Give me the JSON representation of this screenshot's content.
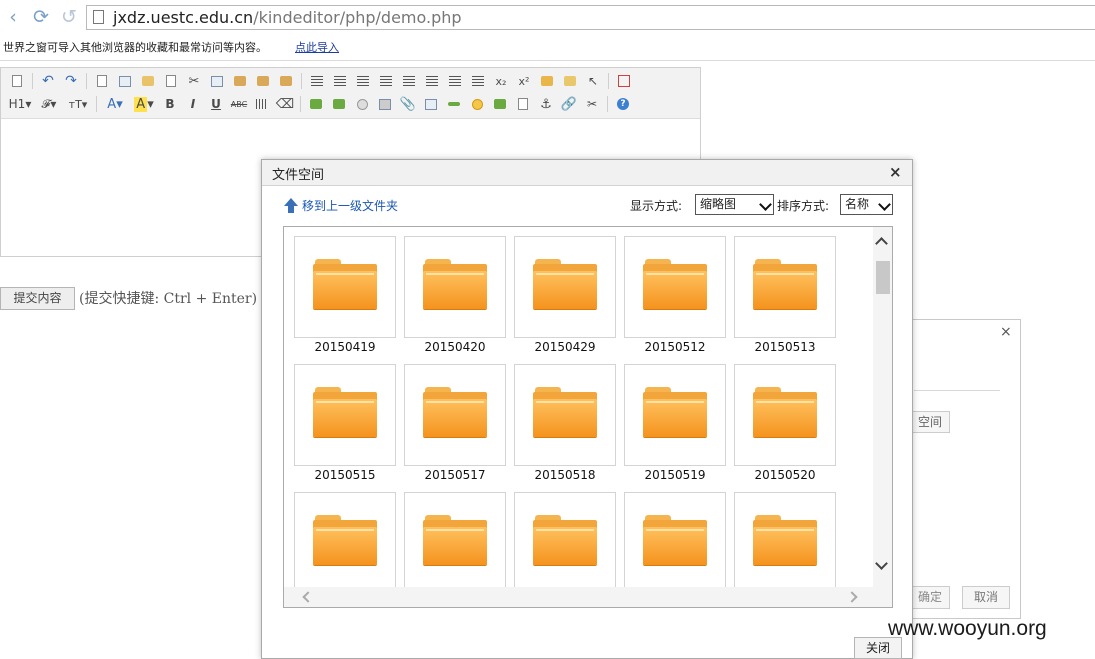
{
  "browser": {
    "url_host": "jxdz.uestc.edu.cn",
    "url_path": "/kindeditor/php/demo.php",
    "import_message": "世界之窗可导入其他浏览器的收藏和最常访问等内容。",
    "import_link": "点此导入"
  },
  "editor": {
    "toolbar_text": {
      "heading": "H1",
      "font": "𝓕",
      "font_size": "тT",
      "font_color": "A",
      "highlight": "A",
      "bold": "B",
      "italic": "I",
      "underline": "U",
      "strikethrough": "ABC",
      "subscript": "x₂",
      "superscript": "x²"
    },
    "submit_label": "提交内容",
    "shortcut_hint": "(提交快捷键: Ctrl + Enter)"
  },
  "background_dialog": {
    "close_symbol": "×",
    "space_button": "空间",
    "ok_button": "确定",
    "cancel_button": "取消"
  },
  "dialog": {
    "title": "文件空间",
    "close_symbol": "×",
    "up_link": "移到上一级文件夹",
    "view_label": "显示方式:",
    "view_value": "缩略图",
    "sort_label": "排序方式:",
    "sort_value": "名称",
    "folders": [
      "20150419",
      "20150420",
      "20150429",
      "20150512",
      "20150513",
      "20150515",
      "20150517",
      "20150518",
      "20150519",
      "20150520",
      "",
      "",
      "",
      "",
      ""
    ],
    "close_button": "关闭"
  },
  "watermark": "www.wooyun.org",
  "colors": {
    "folder": "#f4a030",
    "link": "#1a57b3",
    "nav_icon": "#7aa0c8"
  }
}
